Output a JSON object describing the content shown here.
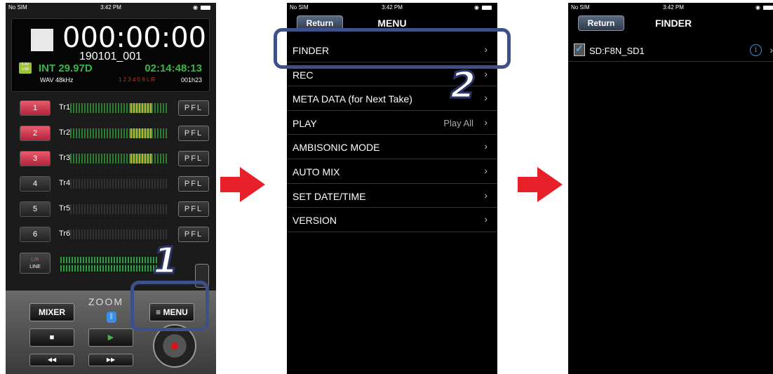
{
  "status": {
    "carrier": "No SIM",
    "time": "3:42 PM"
  },
  "recorder": {
    "timecode": "000:00:00",
    "take_name": "190101_001",
    "usb_badge": "5.0V USB",
    "int_timecode": "INT 29.97D",
    "run_timecode": "02:14:48:13",
    "format": "WAV 48kHz",
    "track_indicators": "1 2 3 4 5 6 L R",
    "remaining": "001h23",
    "tracks": [
      {
        "number": "1",
        "name": "Tr1",
        "armed": true,
        "pfl": "PFL"
      },
      {
        "number": "2",
        "name": "Tr2",
        "armed": true,
        "pfl": "PFL"
      },
      {
        "number": "3",
        "name": "Tr3",
        "armed": true,
        "pfl": "PFL"
      },
      {
        "number": "4",
        "name": "Tr4",
        "armed": false,
        "pfl": "PFL"
      },
      {
        "number": "5",
        "name": "Tr5",
        "armed": false,
        "pfl": "PFL"
      },
      {
        "number": "6",
        "name": "Tr6",
        "armed": false,
        "pfl": "PFL"
      }
    ],
    "lr_button": {
      "top": "L/R",
      "bottom": "LINE"
    },
    "mixer_label": "MIXER",
    "brand": "ZOOM",
    "menu_label": "≡ MENU",
    "stop_label": "■",
    "play_label": "▶",
    "rew_label": "◀◀",
    "ff_label": "▶▶"
  },
  "steps": {
    "one": "1",
    "two": "2"
  },
  "menu": {
    "return_label": "Return",
    "title": "MENU",
    "items": [
      {
        "label": "FINDER",
        "value": ""
      },
      {
        "label": "REC",
        "value": ""
      },
      {
        "label": "META DATA (for Next Take)",
        "value": ""
      },
      {
        "label": "PLAY",
        "value": "Play All"
      },
      {
        "label": "AMBISONIC MODE",
        "value": ""
      },
      {
        "label": "AUTO MIX",
        "value": ""
      },
      {
        "label": "SET DATE/TIME",
        "value": ""
      },
      {
        "label": "VERSION",
        "value": ""
      }
    ]
  },
  "finder": {
    "return_label": "Return",
    "title": "FINDER",
    "card_name": "SD:F8N_SD1"
  },
  "colors": {
    "highlight": "#3f4f8a",
    "arrow": "#e8202a",
    "meter_green": "#2e7d32",
    "info_blue": "#2f8ff0"
  }
}
